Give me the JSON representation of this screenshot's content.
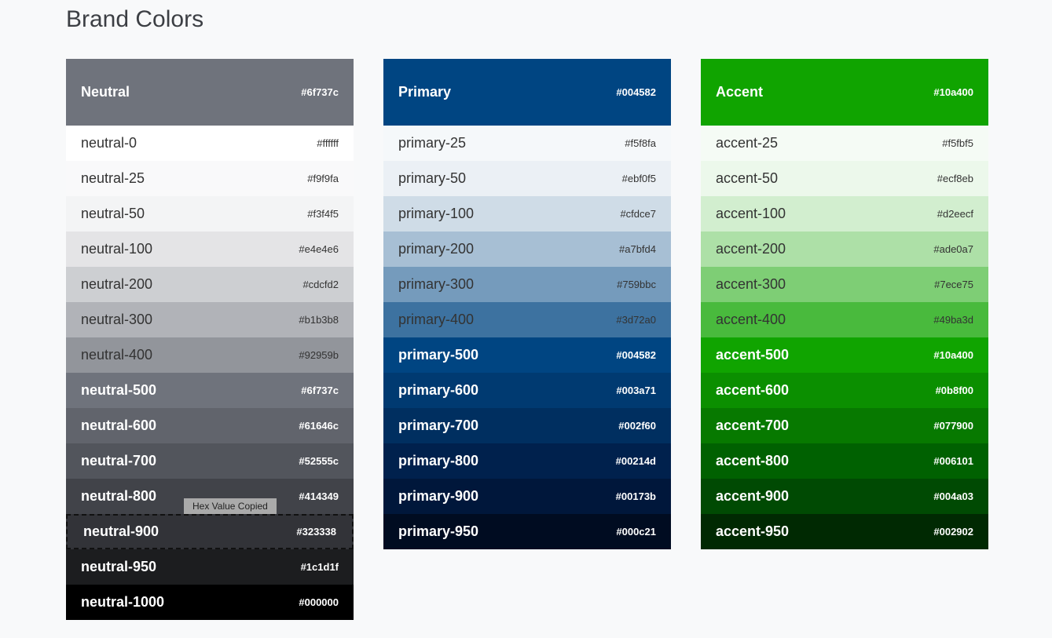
{
  "page": {
    "title": "Brand Colors",
    "tooltip": "Hex Value Copied"
  },
  "palettes": [
    {
      "name": "Neutral",
      "hex": "#6f737c",
      "swatches": [
        {
          "label": "neutral-0",
          "hex": "#ffffff",
          "color": "#ffffff",
          "text": "dark"
        },
        {
          "label": "neutral-25",
          "hex": "#f9f9fa",
          "color": "#f9f9fa",
          "text": "dark"
        },
        {
          "label": "neutral-50",
          "hex": "#f3f4f5",
          "color": "#f3f4f5",
          "text": "dark"
        },
        {
          "label": "neutral-100",
          "hex": "#e4e4e6",
          "color": "#e4e4e6",
          "text": "dark"
        },
        {
          "label": "neutral-200",
          "hex": "#cdcfd2",
          "color": "#cdcfd2",
          "text": "dark"
        },
        {
          "label": "neutral-300",
          "hex": "#b1b3b8",
          "color": "#b1b3b8",
          "text": "dark"
        },
        {
          "label": "neutral-400",
          "hex": "#92959b",
          "color": "#92959b",
          "text": "dark"
        },
        {
          "label": "neutral-500",
          "hex": "#6f737c",
          "color": "#6f737c",
          "text": "light"
        },
        {
          "label": "neutral-600",
          "hex": "#61646c",
          "color": "#61646c",
          "text": "light"
        },
        {
          "label": "neutral-700",
          "hex": "#52555c",
          "color": "#52555c",
          "text": "light"
        },
        {
          "label": "neutral-800",
          "hex": "#414349",
          "color": "#414349",
          "text": "light"
        },
        {
          "label": "neutral-900",
          "hex": "#323338",
          "color": "#323338",
          "text": "light",
          "selected": true
        },
        {
          "label": "neutral-950",
          "hex": "#1c1d1f",
          "color": "#1c1d1f",
          "text": "light"
        },
        {
          "label": "neutral-1000",
          "hex": "#000000",
          "color": "#000000",
          "text": "light"
        }
      ]
    },
    {
      "name": "Primary",
      "hex": "#004582",
      "swatches": [
        {
          "label": "primary-25",
          "hex": "#f5f8fa",
          "color": "#f5f8fa",
          "text": "dark"
        },
        {
          "label": "primary-50",
          "hex": "#ebf0f5",
          "color": "#ebf0f5",
          "text": "dark"
        },
        {
          "label": "primary-100",
          "hex": "#cfdce7",
          "color": "#cfdce7",
          "text": "dark"
        },
        {
          "label": "primary-200",
          "hex": "#a7bfd4",
          "color": "#a7bfd4",
          "text": "dark"
        },
        {
          "label": "primary-300",
          "hex": "#759bbc",
          "color": "#759bbc",
          "text": "dark"
        },
        {
          "label": "primary-400",
          "hex": "#3d72a0",
          "color": "#3d72a0",
          "text": "dark"
        },
        {
          "label": "primary-500",
          "hex": "#004582",
          "color": "#004582",
          "text": "light"
        },
        {
          "label": "primary-600",
          "hex": "#003a71",
          "color": "#003a71",
          "text": "light"
        },
        {
          "label": "primary-700",
          "hex": "#002f60",
          "color": "#002f60",
          "text": "light"
        },
        {
          "label": "primary-800",
          "hex": "#00214d",
          "color": "#00214d",
          "text": "light"
        },
        {
          "label": "primary-900",
          "hex": "#00173b",
          "color": "#00173b",
          "text": "light"
        },
        {
          "label": "primary-950",
          "hex": "#000c21",
          "color": "#000c21",
          "text": "light"
        }
      ]
    },
    {
      "name": "Accent",
      "hex": "#10a400",
      "swatches": [
        {
          "label": "accent-25",
          "hex": "#f5fbf5",
          "color": "#f5fbf5",
          "text": "dark"
        },
        {
          "label": "accent-50",
          "hex": "#ecf8eb",
          "color": "#ecf8eb",
          "text": "dark"
        },
        {
          "label": "accent-100",
          "hex": "#d2eecf",
          "color": "#d2eecf",
          "text": "dark"
        },
        {
          "label": "accent-200",
          "hex": "#ade0a7",
          "color": "#ade0a7",
          "text": "dark"
        },
        {
          "label": "accent-300",
          "hex": "#7ece75",
          "color": "#7ece75",
          "text": "dark"
        },
        {
          "label": "accent-400",
          "hex": "#49ba3d",
          "color": "#49ba3d",
          "text": "dark"
        },
        {
          "label": "accent-500",
          "hex": "#10a400",
          "color": "#10a400",
          "text": "light"
        },
        {
          "label": "accent-600",
          "hex": "#0b8f00",
          "color": "#0b8f00",
          "text": "light"
        },
        {
          "label": "accent-700",
          "hex": "#077900",
          "color": "#077900",
          "text": "light"
        },
        {
          "label": "accent-800",
          "hex": "#006101",
          "color": "#006101",
          "text": "light"
        },
        {
          "label": "accent-900",
          "hex": "#004a03",
          "color": "#004a03",
          "text": "light"
        },
        {
          "label": "accent-950",
          "hex": "#002902",
          "color": "#002902",
          "text": "light"
        }
      ]
    }
  ]
}
